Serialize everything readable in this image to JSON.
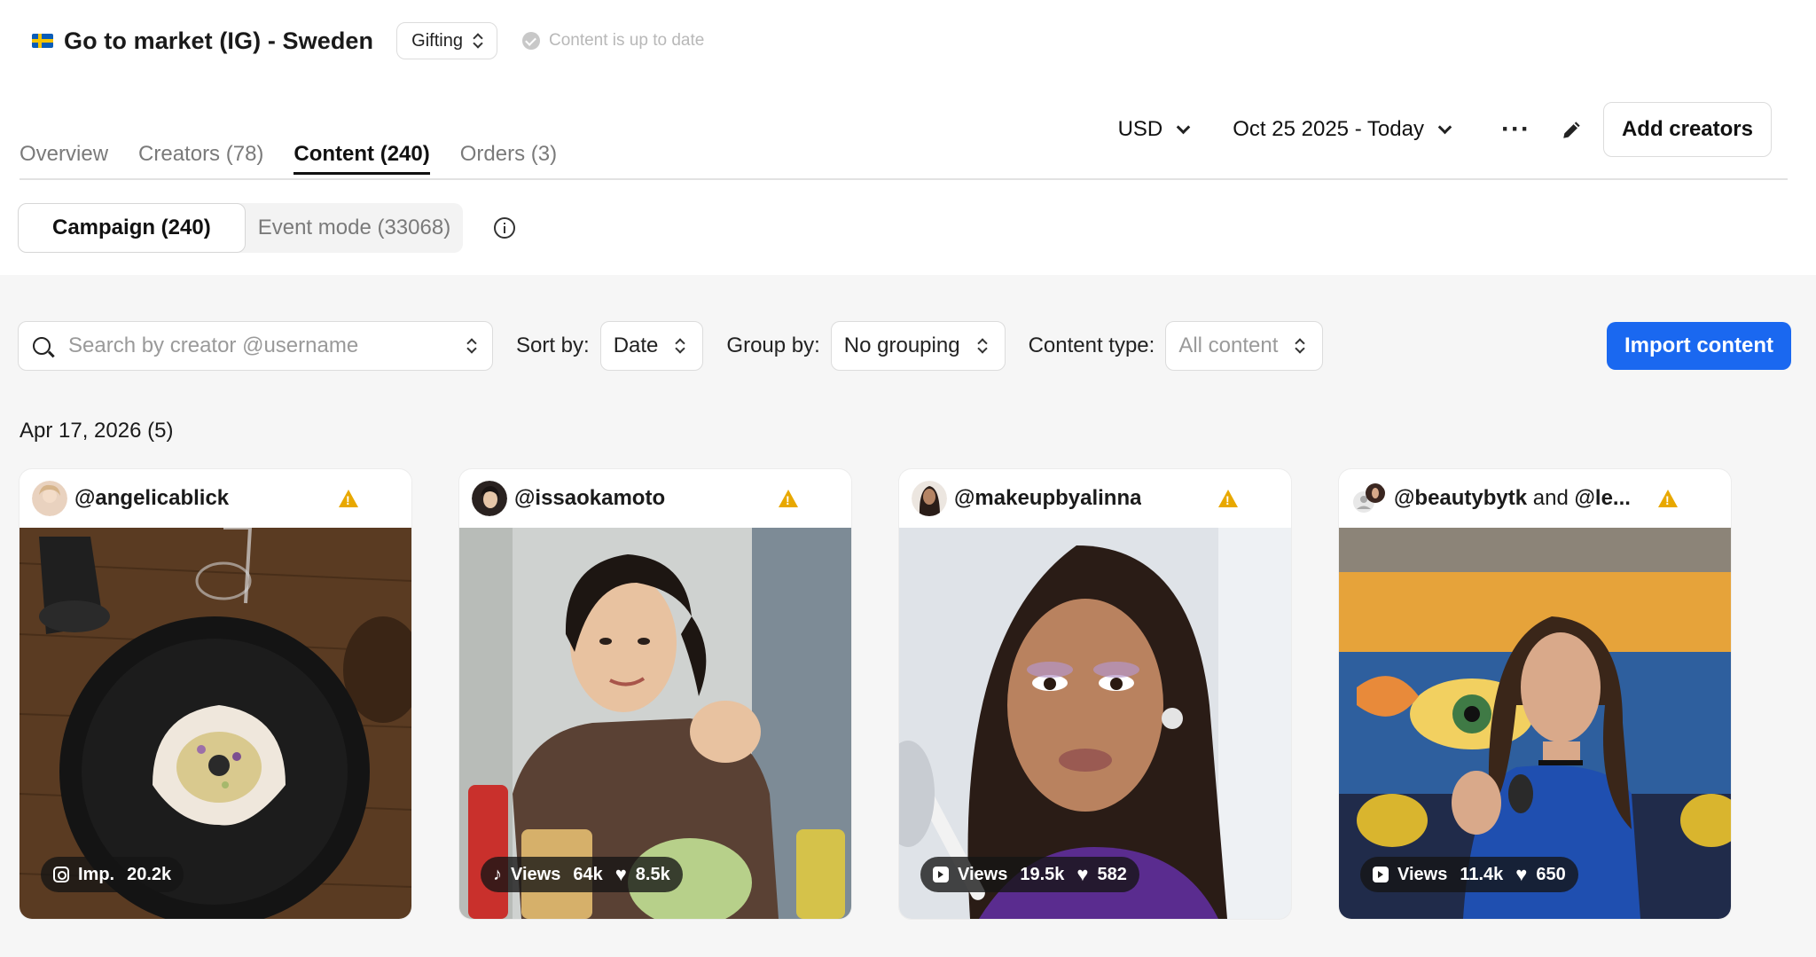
{
  "header": {
    "campaign_title": "Go to market (IG) - Sweden",
    "campaign_type": "Gifting",
    "status_text": "Content is up to date"
  },
  "tabs": [
    {
      "label": "Overview",
      "active": false
    },
    {
      "label": "Creators (78)",
      "active": false
    },
    {
      "label": "Content (240)",
      "active": true
    },
    {
      "label": "Orders (3)",
      "active": false
    }
  ],
  "toolbar": {
    "currency": "USD",
    "date_range": "Oct 25 2025 - Today",
    "add_creators_label": "Add creators"
  },
  "segments": {
    "campaign": "Campaign (240)",
    "event_mode": "Event mode (33068)"
  },
  "filters": {
    "search_placeholder": "Search by creator @username",
    "sort_label": "Sort by:",
    "sort_value": "Date",
    "group_label": "Group by:",
    "group_value": "No grouping",
    "content_type_label": "Content type:",
    "content_type_value": "All content",
    "import_label": "Import content"
  },
  "group": {
    "date_label": "Apr 17, 2026 (5)"
  },
  "cards": [
    {
      "handle": "@angelicablick",
      "platform_icon": "instagram-icon",
      "metric_label": "Imp.",
      "metric_value": "20.2k"
    },
    {
      "handle": "@issaokamoto",
      "platform_icon": "tiktok-icon",
      "metric_label": "Views",
      "metric_value": "64k",
      "likes": "8.5k"
    },
    {
      "handle": "@makeupbyalinna",
      "platform_icon": "reel-icon",
      "metric_label": "Views",
      "metric_value": "19.5k",
      "likes": "582"
    },
    {
      "handle_1": "@beautybytk",
      "handle_and": "and",
      "handle_2": "@le...",
      "platform_icon": "reel-icon",
      "metric_label": "Views",
      "metric_value": "11.4k",
      "likes": "650"
    }
  ],
  "colors": {
    "accent": "#1a68f0",
    "warning": "#e8a800",
    "content_bg": "#f6f6f6"
  }
}
